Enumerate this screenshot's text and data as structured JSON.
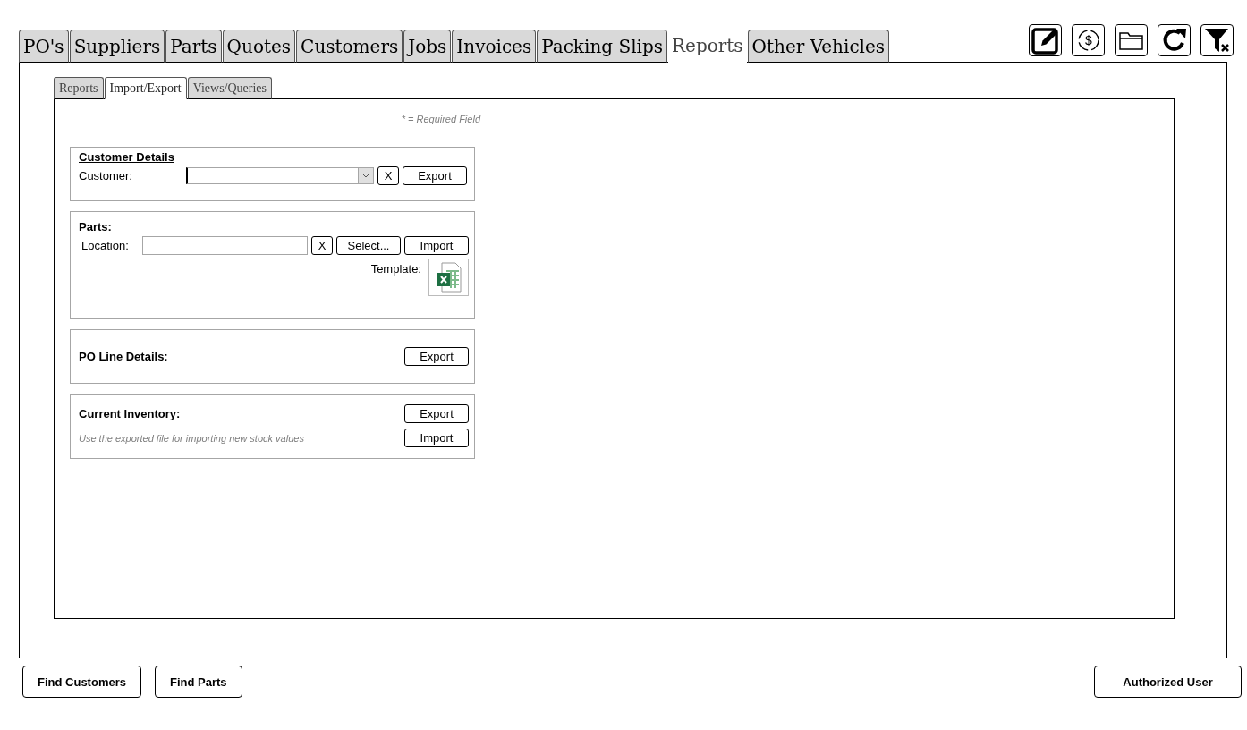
{
  "main_tabs": [
    {
      "label": "PO's",
      "selected": false
    },
    {
      "label": "Suppliers",
      "selected": false
    },
    {
      "label": "Parts",
      "selected": false
    },
    {
      "label": "Quotes",
      "selected": false
    },
    {
      "label": "Customers",
      "selected": false
    },
    {
      "label": "Jobs",
      "selected": false
    },
    {
      "label": "Invoices",
      "selected": false
    },
    {
      "label": "Packing Slips",
      "selected": false
    },
    {
      "label": "Reports",
      "selected": true
    },
    {
      "label": "Other Vehicles",
      "selected": false
    }
  ],
  "sub_tabs": [
    {
      "label": "Reports",
      "selected": false
    },
    {
      "label": "Import/Export",
      "selected": true
    },
    {
      "label": "Views/Queries",
      "selected": false
    }
  ],
  "currency_icon_glyph": "$",
  "required_note": "* = Required Field",
  "customer_details": {
    "title": "Customer Details",
    "label": "Customer:",
    "clear_button": "X",
    "export_button": "Export"
  },
  "parts": {
    "title": "Parts:",
    "label": "Location:",
    "clear_button": "X",
    "select_button": "Select...",
    "import_button": "Import",
    "template_label": "Template:"
  },
  "po_line_details": {
    "title": "PO Line Details:",
    "export_button": "Export"
  },
  "current_inventory": {
    "title": "Current Inventory:",
    "note": "Use the exported file for importing new stock values",
    "export_button": "Export",
    "import_button": "Import"
  },
  "footer_left_buttons": [
    "Find Customers",
    "Find Parts"
  ],
  "footer_right_button": "Authorized User"
}
